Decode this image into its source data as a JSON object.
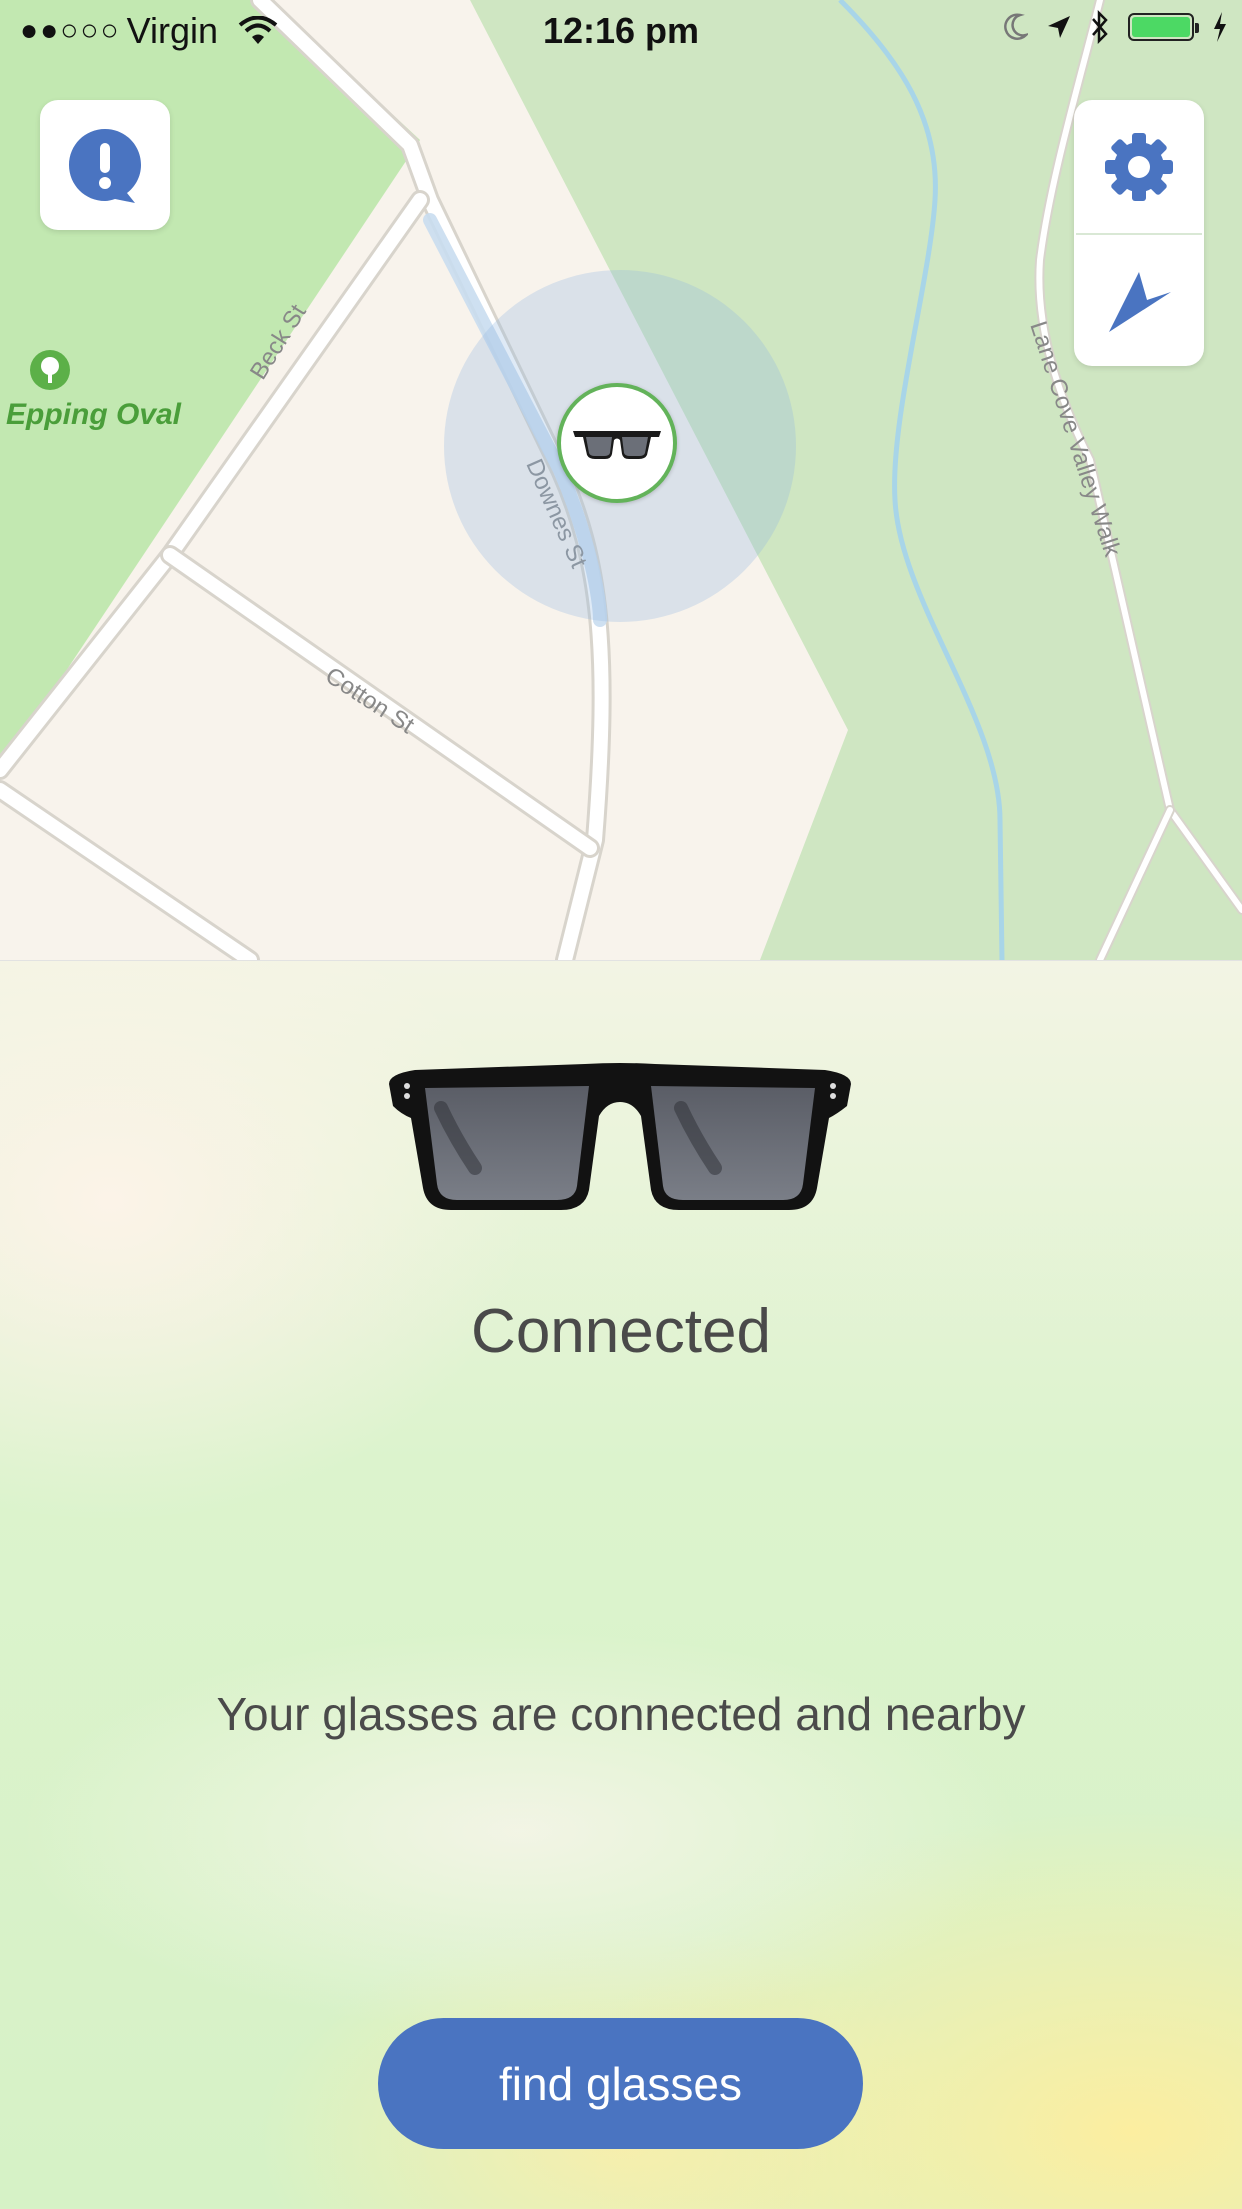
{
  "status_bar": {
    "carrier_signal": "●●○○○",
    "carrier": "Virgin",
    "time": "12:16 pm"
  },
  "map": {
    "streets": [
      {
        "name": "Beck St"
      },
      {
        "name": "Downes St"
      },
      {
        "name": "Cotton St"
      },
      {
        "name": "Lane Cove Valley Walk"
      }
    ],
    "park_label": "Epping Oval"
  },
  "controls": {
    "alert_icon": "alert-bubble-icon",
    "settings_icon": "gear-icon",
    "location_icon": "location-arrow-icon"
  },
  "device": {
    "status": "Connected",
    "message": "Your glasses are connected and nearby",
    "action": "find glasses"
  },
  "colors": {
    "accent_blue": "#4a74c1",
    "pin_ring_green": "#63b35a",
    "battery_green": "#4cd964"
  }
}
